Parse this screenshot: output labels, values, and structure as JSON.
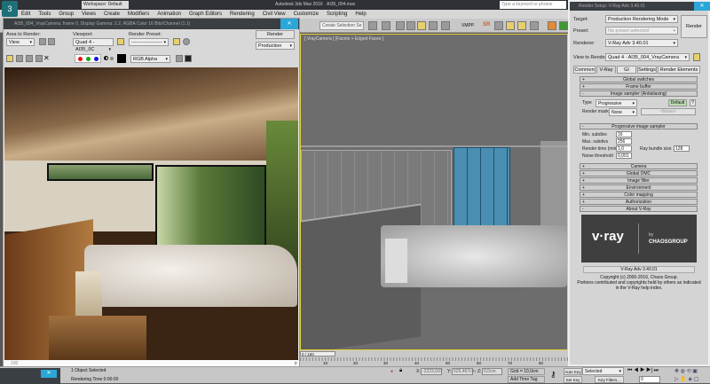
{
  "app": {
    "title": "Autodesk 3ds Max 2016",
    "file": "AI35_004.max",
    "workspace": "Workspace: Default",
    "search_placeholder": "Type a keyword or phrase"
  },
  "menu": [
    "Edit",
    "Tools",
    "Group",
    "Views",
    "Create",
    "Modifiers",
    "Animation",
    "Graph Editors",
    "Rendering",
    "Civil View",
    "Customize",
    "Scripting",
    "Help"
  ],
  "toolbar": {
    "selection_set": "Create Selection Se",
    "vmpp": "VMPP",
    "sr": "SR"
  },
  "viewport": {
    "label": "[ VrayCamera ] [Facets + Edged Faces ]"
  },
  "frame_buffer": {
    "title": "AI35_004_VrayCamera, frame 0, Display Gamma: 2.2, RGBA Color 16 Bits/Channel (1:1)",
    "area_label": "Area to Render:",
    "area_value": "View",
    "viewport_label": "Viewport:",
    "viewport_value": "Quad 4 - AI35_0C",
    "preset_label": "Render Preset:",
    "preset_value": "-------------------",
    "render_button": "Render",
    "mode_value": "Production",
    "channel_value": "RGB Alpha",
    "bottom_text": "100"
  },
  "render_setup": {
    "title": "Render Setup: V-Ray Adv 3.40.01",
    "target_label": "Target:",
    "target_value": "Production Rendering Mode",
    "preset_label": "Preset:",
    "preset_value": "No preset selected",
    "renderer_label": "Renderer:",
    "renderer_value": "V-Ray Adv 3.40.01",
    "view_label": "View to Render:",
    "view_value": "Quad 4 - AI35_004_VrayCamera",
    "render_button": "Render",
    "tabs": [
      "Common",
      "V-Ray",
      "GI",
      "Settings",
      "Render Elements"
    ],
    "active_tab": "V-Ray",
    "rollouts_top": [
      "Global switches",
      "Frame buffer",
      "Image sampler (Antialiasing)"
    ],
    "sampler": {
      "type_label": "Type",
      "type_value": "Progressive",
      "default_button": "Default",
      "help": "?",
      "mask_label": "Render mask",
      "mask_value": "None",
      "none_button": "<None>"
    },
    "progressive_title": "Progressive image sampler",
    "progressive": [
      {
        "label": "Min. subdivs",
        "value": "16"
      },
      {
        "label": "Max. subdivs",
        "value": "256"
      },
      {
        "label": "Render time (min)",
        "value": "1,0"
      },
      {
        "label": "Noise threshold",
        "value": "0,001"
      }
    ],
    "ray_bundle_label": "Ray bundle size",
    "ray_bundle_value": "128",
    "rollouts_bottom": [
      "Camera",
      "Global DMC",
      "Image filter",
      "Environment",
      "Color mapping",
      "Authorization",
      "About V-Ray"
    ],
    "logo_text": "v·ray",
    "logo_by": "by",
    "logo_company": "CHAOSGROUP",
    "version": "V-Ray Adv 3.40.01",
    "copyright": [
      "Copyright (c) 2000-2016, Chaos Group.",
      "Portions contributed and copyrights held by others as indicated",
      "in the V-Ray help index."
    ]
  },
  "timeline": {
    "frame_range": "0 / 100",
    "ticks": [
      "0",
      "10",
      "20",
      "30",
      "40",
      "50",
      "60",
      "70",
      "80"
    ]
  },
  "status": {
    "selected": "1 Object Selected",
    "render_time": "Rendering Time  0:00:00",
    "x_label": "X:",
    "x": "-2223,597",
    "y_label": "Y:",
    "y": "529,467cm",
    "z_label": "Z:",
    "z": "0,0cm",
    "grid": "Grid = 10,0cm",
    "add_time_tag": "Add Time Tag",
    "auto_key": "Auto Key",
    "set_key": "Set Key",
    "selected_dd": "Selected",
    "key_filters": "Key Filters...",
    "frame": "0"
  }
}
